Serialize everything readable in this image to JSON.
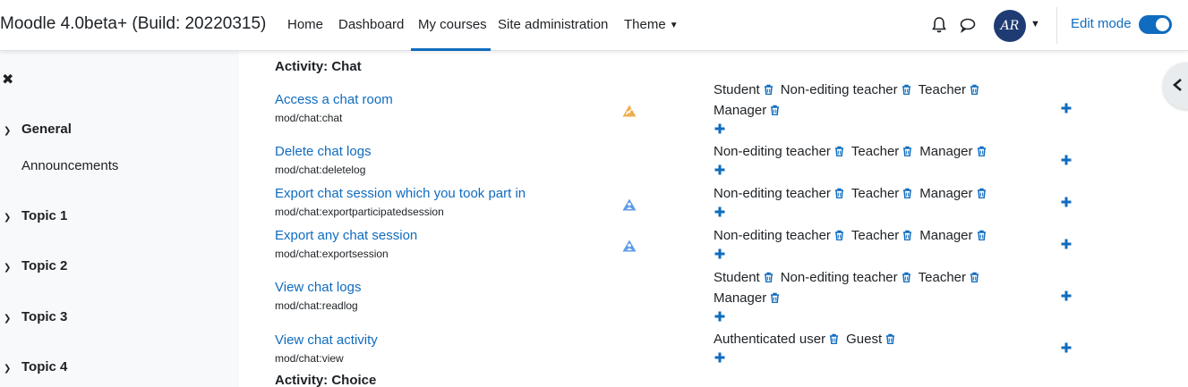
{
  "navbar": {
    "brand": "Moodle 4.0beta+ (Build: 20220315)",
    "items": [
      {
        "label": "Home"
      },
      {
        "label": "Dashboard"
      },
      {
        "label": "My courses",
        "active": true
      },
      {
        "label": "Site administration"
      },
      {
        "label": "Theme"
      }
    ],
    "avatar_initials": "AR",
    "edit_mode_label": "Edit mode",
    "edit_mode_on": true
  },
  "drawer": {
    "sections": [
      {
        "label": "General",
        "items": [
          "Announcements"
        ]
      },
      {
        "label": "Topic 1"
      },
      {
        "label": "Topic 2"
      },
      {
        "label": "Topic 3"
      },
      {
        "label": "Topic 4"
      }
    ]
  },
  "main": {
    "heading": "Activity: Chat",
    "next_heading": "Activity: Choice",
    "capabilities": [
      {
        "title": "Access a chat room",
        "name": "mod/chat:chat",
        "risk": "spam",
        "roles": [
          "Student",
          "Non-editing teacher",
          "Teacher",
          "Manager"
        ]
      },
      {
        "title": "Delete chat logs",
        "name": "mod/chat:deletelog",
        "risk": "",
        "roles": [
          "Non-editing teacher",
          "Teacher",
          "Manager"
        ]
      },
      {
        "title": "Export chat session which you took part in",
        "name": "mod/chat:exportparticipatedsession",
        "risk": "personal",
        "roles": [
          "Non-editing teacher",
          "Teacher",
          "Manager"
        ]
      },
      {
        "title": "Export any chat session",
        "name": "mod/chat:exportsession",
        "risk": "personal",
        "roles": [
          "Non-editing teacher",
          "Teacher",
          "Manager"
        ]
      },
      {
        "title": "View chat logs",
        "name": "mod/chat:readlog",
        "risk": "",
        "roles": [
          "Student",
          "Non-editing teacher",
          "Teacher",
          "Manager"
        ]
      },
      {
        "title": "View chat activity",
        "name": "mod/chat:view",
        "risk": "",
        "roles": [
          "Authenticated user",
          "Guest"
        ]
      }
    ]
  },
  "colors": {
    "accent": "#0f6cbf",
    "risk_spam": "#f0ad4e",
    "risk_personal": "#5f9be8"
  }
}
